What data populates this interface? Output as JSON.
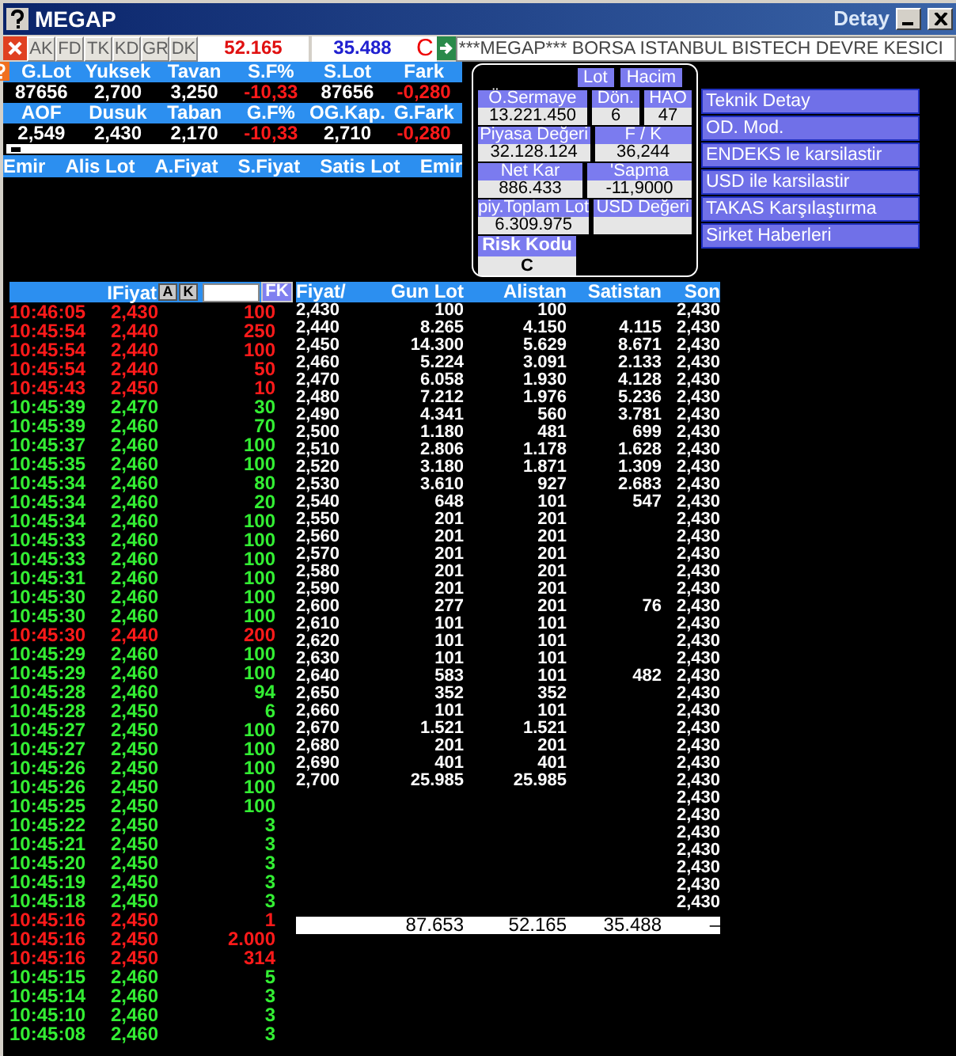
{
  "window": {
    "title": "MEGAP",
    "subtitle": "Detay"
  },
  "toolbar": {
    "buttons": [
      "AK",
      "FD",
      "TK",
      "KD",
      "GR",
      "DK"
    ],
    "bid_total": "52.165",
    "ask_total": "35.488",
    "code": "C",
    "ticker": "***MEGAP*** BORSA ISTANBUL BISTECH DEVRE KESICI"
  },
  "stats": [
    [
      {
        "label": "G.Lot",
        "value": "87656",
        "negative": false
      },
      {
        "label": "Yuksek",
        "value": "2,700",
        "negative": false
      },
      {
        "label": "Tavan",
        "value": "3,250",
        "negative": false
      },
      {
        "label": "S.F%",
        "value": "-10,33",
        "negative": true
      },
      {
        "label": "S.Lot",
        "value": "87656",
        "negative": false
      },
      {
        "label": "Fark",
        "value": "-0,280",
        "negative": true
      }
    ],
    [
      {
        "label": "AOF",
        "value": "2,549",
        "negative": false
      },
      {
        "label": "Dusuk",
        "value": "2,430",
        "negative": false
      },
      {
        "label": "Taban",
        "value": "2,170",
        "negative": false
      },
      {
        "label": "G.F%",
        "value": "-10,33",
        "negative": true
      },
      {
        "label": "OG.Kap.",
        "value": "2,710",
        "negative": false
      },
      {
        "label": "G.Fark",
        "value": "-0,280",
        "negative": true
      }
    ]
  ],
  "order_book": {
    "columns": [
      "Emir",
      "Alis Lot",
      "A.Fiyat",
      "S.Fiyat",
      "Satis Lot",
      "Emir"
    ]
  },
  "detail": {
    "tabs": [
      "Lot",
      "Hacim"
    ],
    "rows": [
      [
        {
          "label": "Ö.Sermaye",
          "value": "13.221.450"
        },
        {
          "label": "Dön.",
          "value": "6"
        },
        {
          "label": "HAO",
          "value": "47"
        }
      ],
      [
        {
          "label": "Piyasa Değeri",
          "value": "32.128.124"
        },
        {
          "label": "F / K",
          "value": "36,244"
        }
      ],
      [
        {
          "label": "Net Kar",
          "value": "886.433"
        },
        {
          "label": "'Sapma",
          "value": "-11,9000"
        }
      ],
      [
        {
          "label": "piy.Toplam Lot",
          "value": "6.309.975"
        },
        {
          "label": "USD Değeri"
        }
      ]
    ],
    "risk": {
      "label": "Risk Kodu",
      "value": "C"
    }
  },
  "menu": [
    "Teknik Detay",
    "OD. Mod.",
    "ENDEKS le karsilastir",
    "USD ile karsilastir",
    "TAKAS Karşılaştırma",
    "Sirket Haberleri"
  ],
  "trades": {
    "header": "IFiyat",
    "buttons": [
      "A",
      "K"
    ],
    "filter_button": "FK",
    "rows": [
      {
        "time": "10:46:05",
        "price": "2,430",
        "lot": "100",
        "color": "#ff1a1a"
      },
      {
        "time": "10:45:54",
        "price": "2,440",
        "lot": "250",
        "color": "#ff1a1a"
      },
      {
        "time": "10:45:54",
        "price": "2,440",
        "lot": "100",
        "color": "#ff1a1a"
      },
      {
        "time": "10:45:54",
        "price": "2,440",
        "lot": "50",
        "color": "#ff1a1a"
      },
      {
        "time": "10:45:43",
        "price": "2,450",
        "lot": "10",
        "color": "#ff1a1a"
      },
      {
        "time": "10:45:39",
        "price": "2,470",
        "lot": "30",
        "color": "#33ee33"
      },
      {
        "time": "10:45:39",
        "price": "2,460",
        "lot": "70",
        "color": "#33ee33"
      },
      {
        "time": "10:45:37",
        "price": "2,460",
        "lot": "100",
        "color": "#33ee33"
      },
      {
        "time": "10:45:35",
        "price": "2,460",
        "lot": "100",
        "color": "#33ee33"
      },
      {
        "time": "10:45:34",
        "price": "2,460",
        "lot": "80",
        "color": "#33ee33"
      },
      {
        "time": "10:45:34",
        "price": "2,460",
        "lot": "20",
        "color": "#33ee33"
      },
      {
        "time": "10:45:34",
        "price": "2,460",
        "lot": "100",
        "color": "#33ee33"
      },
      {
        "time": "10:45:33",
        "price": "2,460",
        "lot": "100",
        "color": "#33ee33"
      },
      {
        "time": "10:45:33",
        "price": "2,460",
        "lot": "100",
        "color": "#33ee33"
      },
      {
        "time": "10:45:31",
        "price": "2,460",
        "lot": "100",
        "color": "#33ee33"
      },
      {
        "time": "10:45:30",
        "price": "2,460",
        "lot": "100",
        "color": "#33ee33"
      },
      {
        "time": "10:45:30",
        "price": "2,460",
        "lot": "100",
        "color": "#33ee33"
      },
      {
        "time": "10:45:30",
        "price": "2,440",
        "lot": "200",
        "color": "#ff1a1a"
      },
      {
        "time": "10:45:29",
        "price": "2,460",
        "lot": "100",
        "color": "#33ee33"
      },
      {
        "time": "10:45:29",
        "price": "2,460",
        "lot": "100",
        "color": "#33ee33"
      },
      {
        "time": "10:45:28",
        "price": "2,460",
        "lot": "94",
        "color": "#33ee33"
      },
      {
        "time": "10:45:28",
        "price": "2,450",
        "lot": "6",
        "color": "#33ee33"
      },
      {
        "time": "10:45:27",
        "price": "2,450",
        "lot": "100",
        "color": "#33ee33"
      },
      {
        "time": "10:45:27",
        "price": "2,450",
        "lot": "100",
        "color": "#33ee33"
      },
      {
        "time": "10:45:26",
        "price": "2,450",
        "lot": "100",
        "color": "#33ee33"
      },
      {
        "time": "10:45:26",
        "price": "2,450",
        "lot": "100",
        "color": "#33ee33"
      },
      {
        "time": "10:45:25",
        "price": "2,450",
        "lot": "100",
        "color": "#33ee33"
      },
      {
        "time": "10:45:22",
        "price": "2,450",
        "lot": "3",
        "color": "#33ee33"
      },
      {
        "time": "10:45:21",
        "price": "2,450",
        "lot": "3",
        "color": "#33ee33"
      },
      {
        "time": "10:45:20",
        "price": "2,450",
        "lot": "3",
        "color": "#33ee33"
      },
      {
        "time": "10:45:19",
        "price": "2,450",
        "lot": "3",
        "color": "#33ee33"
      },
      {
        "time": "10:45:18",
        "price": "2,450",
        "lot": "3",
        "color": "#33ee33"
      },
      {
        "time": "10:45:16",
        "price": "2,450",
        "lot": "1",
        "color": "#ff1a1a"
      },
      {
        "time": "10:45:16",
        "price": "2,450",
        "lot": "2.000",
        "color": "#ff1a1a"
      },
      {
        "time": "10:45:16",
        "price": "2,450",
        "lot": "314",
        "color": "#ff1a1a"
      },
      {
        "time": "10:45:15",
        "price": "2,460",
        "lot": "5",
        "color": "#33ee33"
      },
      {
        "time": "10:45:14",
        "price": "2,460",
        "lot": "3",
        "color": "#33ee33"
      },
      {
        "time": "10:45:10",
        "price": "2,460",
        "lot": "3",
        "color": "#33ee33"
      },
      {
        "time": "10:45:08",
        "price": "2,460",
        "lot": "3",
        "color": "#33ee33"
      }
    ]
  },
  "depth": {
    "columns": [
      "Fiyat/",
      "Gun Lot",
      "Alistan",
      "Satistan",
      "Son"
    ],
    "rows": [
      {
        "fiyat": "2,430",
        "gun_lot": "100",
        "alistan": "100",
        "son": "2,430"
      },
      {
        "fiyat": "2,440",
        "gun_lot": "8.265",
        "alistan": "4.150",
        "satistan": "4.115",
        "son": "2,430"
      },
      {
        "fiyat": "2,450",
        "gun_lot": "14.300",
        "alistan": "5.629",
        "satistan": "8.671",
        "son": "2,430"
      },
      {
        "fiyat": "2,460",
        "gun_lot": "5.224",
        "alistan": "3.091",
        "satistan": "2.133",
        "son": "2,430"
      },
      {
        "fiyat": "2,470",
        "gun_lot": "6.058",
        "alistan": "1.930",
        "satistan": "4.128",
        "son": "2,430"
      },
      {
        "fiyat": "2,480",
        "gun_lot": "7.212",
        "alistan": "1.976",
        "satistan": "5.236",
        "son": "2,430"
      },
      {
        "fiyat": "2,490",
        "gun_lot": "4.341",
        "alistan": "560",
        "satistan": "3.781",
        "son": "2,430"
      },
      {
        "fiyat": "2,500",
        "gun_lot": "1.180",
        "alistan": "481",
        "satistan": "699",
        "son": "2,430"
      },
      {
        "fiyat": "2,510",
        "gun_lot": "2.806",
        "alistan": "1.178",
        "satistan": "1.628",
        "son": "2,430"
      },
      {
        "fiyat": "2,520",
        "gun_lot": "3.180",
        "alistan": "1.871",
        "satistan": "1.309",
        "son": "2,430"
      },
      {
        "fiyat": "2,530",
        "gun_lot": "3.610",
        "alistan": "927",
        "satistan": "2.683",
        "son": "2,430"
      },
      {
        "fiyat": "2,540",
        "gun_lot": "648",
        "alistan": "101",
        "satistan": "547",
        "son": "2,430"
      },
      {
        "fiyat": "2,550",
        "gun_lot": "201",
        "alistan": "201",
        "son": "2,430"
      },
      {
        "fiyat": "2,560",
        "gun_lot": "201",
        "alistan": "201",
        "son": "2,430"
      },
      {
        "fiyat": "2,570",
        "gun_lot": "201",
        "alistan": "201",
        "son": "2,430"
      },
      {
        "fiyat": "2,580",
        "gun_lot": "201",
        "alistan": "201",
        "son": "2,430"
      },
      {
        "fiyat": "2,590",
        "gun_lot": "201",
        "alistan": "201",
        "son": "2,430"
      },
      {
        "fiyat": "2,600",
        "gun_lot": "277",
        "alistan": "201",
        "satistan": "76",
        "son": "2,430"
      },
      {
        "fiyat": "2,610",
        "gun_lot": "101",
        "alistan": "101",
        "son": "2,430"
      },
      {
        "fiyat": "2,620",
        "gun_lot": "101",
        "alistan": "101",
        "son": "2,430"
      },
      {
        "fiyat": "2,630",
        "gun_lot": "101",
        "alistan": "101",
        "son": "2,430"
      },
      {
        "fiyat": "2,640",
        "gun_lot": "583",
        "alistan": "101",
        "satistan": "482",
        "son": "2,430"
      },
      {
        "fiyat": "2,650",
        "gun_lot": "352",
        "alistan": "352",
        "son": "2,430"
      },
      {
        "fiyat": "2,660",
        "gun_lot": "101",
        "alistan": "101",
        "son": "2,430"
      },
      {
        "fiyat": "2,670",
        "gun_lot": "1.521",
        "alistan": "1.521",
        "son": "2,430"
      },
      {
        "fiyat": "2,680",
        "gun_lot": "201",
        "alistan": "201",
        "son": "2,430"
      },
      {
        "fiyat": "2,690",
        "gun_lot": "401",
        "alistan": "401",
        "son": "2,430"
      },
      {
        "fiyat": "2,700",
        "gun_lot": "25.985",
        "alistan": "25.985",
        "son": "2,430"
      },
      {
        "son": "2,430"
      },
      {
        "son": "2,430"
      },
      {
        "son": "2,430"
      },
      {
        "son": "2,430"
      },
      {
        "son": "2,430"
      },
      {
        "son": "2,430"
      },
      {
        "son": "2,430"
      }
    ],
    "totals": {
      "gun_lot": "87.653",
      "alistan": "52.165",
      "satistan": "35.488",
      "son": "–"
    }
  }
}
